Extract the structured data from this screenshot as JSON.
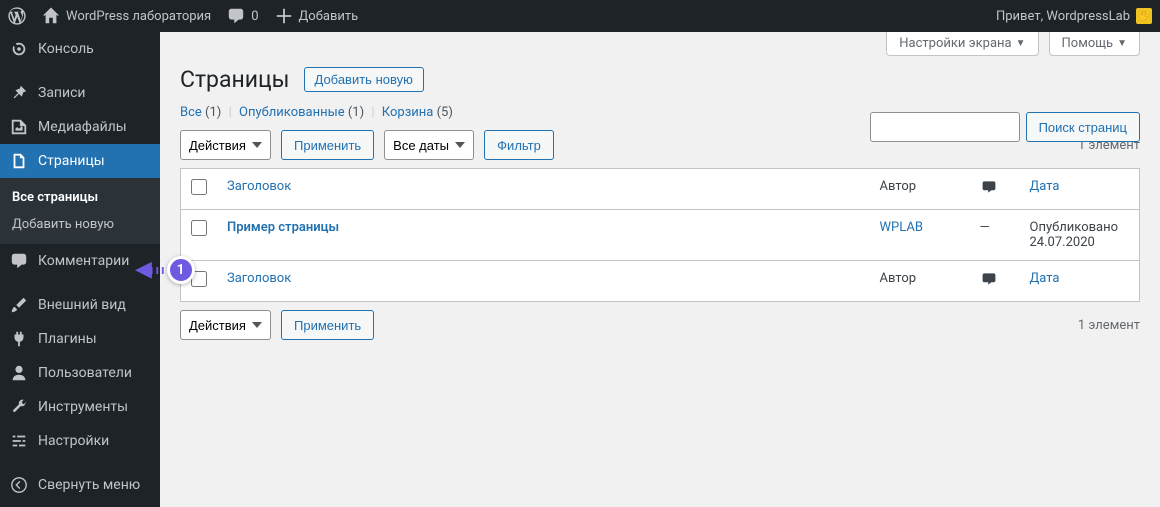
{
  "adminbar": {
    "site_name": "WordPress лаборатория",
    "comments_count": "0",
    "add_new": "Добавить",
    "howdy": "Привет, WordpressLab"
  },
  "sidebar": {
    "items": [
      {
        "label": "Консоль"
      },
      {
        "label": "Записи"
      },
      {
        "label": "Медиафайлы"
      },
      {
        "label": "Страницы"
      },
      {
        "label": "Комментарии"
      },
      {
        "label": "Внешний вид"
      },
      {
        "label": "Плагины"
      },
      {
        "label": "Пользователи"
      },
      {
        "label": "Инструменты"
      },
      {
        "label": "Настройки"
      },
      {
        "label": "Свернуть меню"
      }
    ],
    "submenu": {
      "all": "Все страницы",
      "add_new": "Добавить новую"
    }
  },
  "annotation": {
    "number": "1"
  },
  "screen_meta": {
    "screen_options": "Настройки экрана",
    "help": "Помощь"
  },
  "page": {
    "title": "Страницы",
    "add_new": "Добавить новую"
  },
  "filters": {
    "all": "Все",
    "all_count": "(1)",
    "published": "Опубликованные",
    "published_count": "(1)",
    "trash": "Корзина",
    "trash_count": "(5)"
  },
  "bulk": {
    "actions_label": "Действия",
    "apply": "Применить",
    "all_dates": "Все даты",
    "filter": "Фильтр"
  },
  "search": {
    "button": "Поиск страниц"
  },
  "tablenav": {
    "count_text": "1 элемент"
  },
  "columns": {
    "title": "Заголовок",
    "author": "Автор",
    "date": "Дата"
  },
  "rows": [
    {
      "title": "Пример страницы",
      "author": "WPLAB",
      "comments": "—",
      "date_status": "Опубликовано",
      "date": "24.07.2020"
    }
  ]
}
